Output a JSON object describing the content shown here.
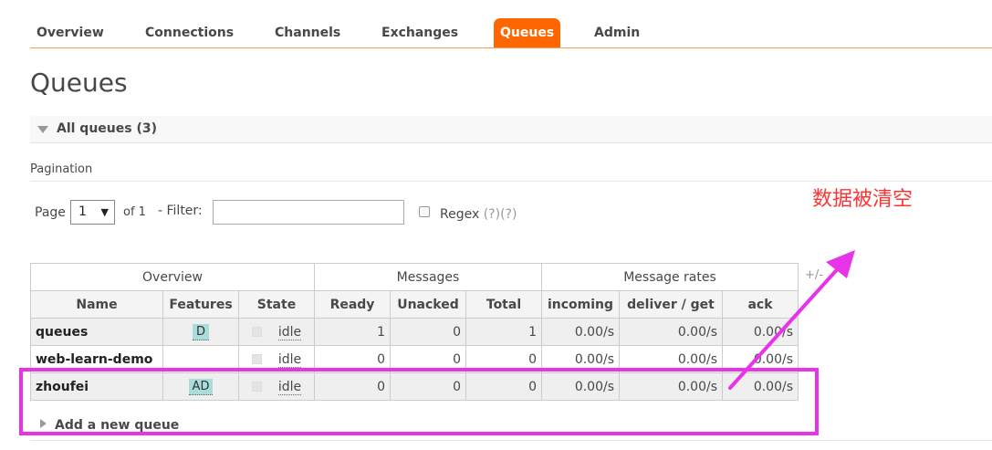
{
  "nav": {
    "items": [
      {
        "label": "Overview",
        "active": false
      },
      {
        "label": "Connections",
        "active": false
      },
      {
        "label": "Channels",
        "active": false
      },
      {
        "label": "Exchanges",
        "active": false
      },
      {
        "label": "Queues",
        "active": true
      },
      {
        "label": "Admin",
        "active": false
      }
    ]
  },
  "page_title": "Queues",
  "section": {
    "label": "All queues (3)"
  },
  "pagination": {
    "heading": "Pagination",
    "page_label": "Page",
    "page_value": "1",
    "of_label": "of 1",
    "filter_label": "- Filter:",
    "filter_value": "",
    "regex_label": "Regex",
    "regex_help": "(?)(?)"
  },
  "table": {
    "group_headers": [
      "Overview",
      "Messages",
      "Message rates"
    ],
    "plus_minus": "+/-",
    "columns": [
      "Name",
      "Features",
      "State",
      "Ready",
      "Unacked",
      "Total",
      "incoming",
      "deliver / get",
      "ack"
    ],
    "rows": [
      {
        "name": "queues",
        "features": "D",
        "state": "idle",
        "ready": "1",
        "unacked": "0",
        "total": "1",
        "incoming": "0.00/s",
        "deliver_get": "0.00/s",
        "ack": "0.00/s"
      },
      {
        "name": "web-learn-demo",
        "features": "",
        "state": "idle",
        "ready": "0",
        "unacked": "0",
        "total": "0",
        "incoming": "0.00/s",
        "deliver_get": "0.00/s",
        "ack": "0.00/s"
      },
      {
        "name": "zhoufei",
        "features": "AD",
        "state": "idle",
        "ready": "0",
        "unacked": "0",
        "total": "0",
        "incoming": "0.00/s",
        "deliver_get": "0.00/s",
        "ack": "0.00/s"
      }
    ]
  },
  "add_queue": {
    "label": "Add a new queue"
  },
  "annotation": {
    "text": "数据被清空",
    "color": "#e833e8",
    "text_color": "#ff3333"
  },
  "colors": {
    "accent": "#ff6600",
    "feature_badge": "#aadcdc"
  }
}
